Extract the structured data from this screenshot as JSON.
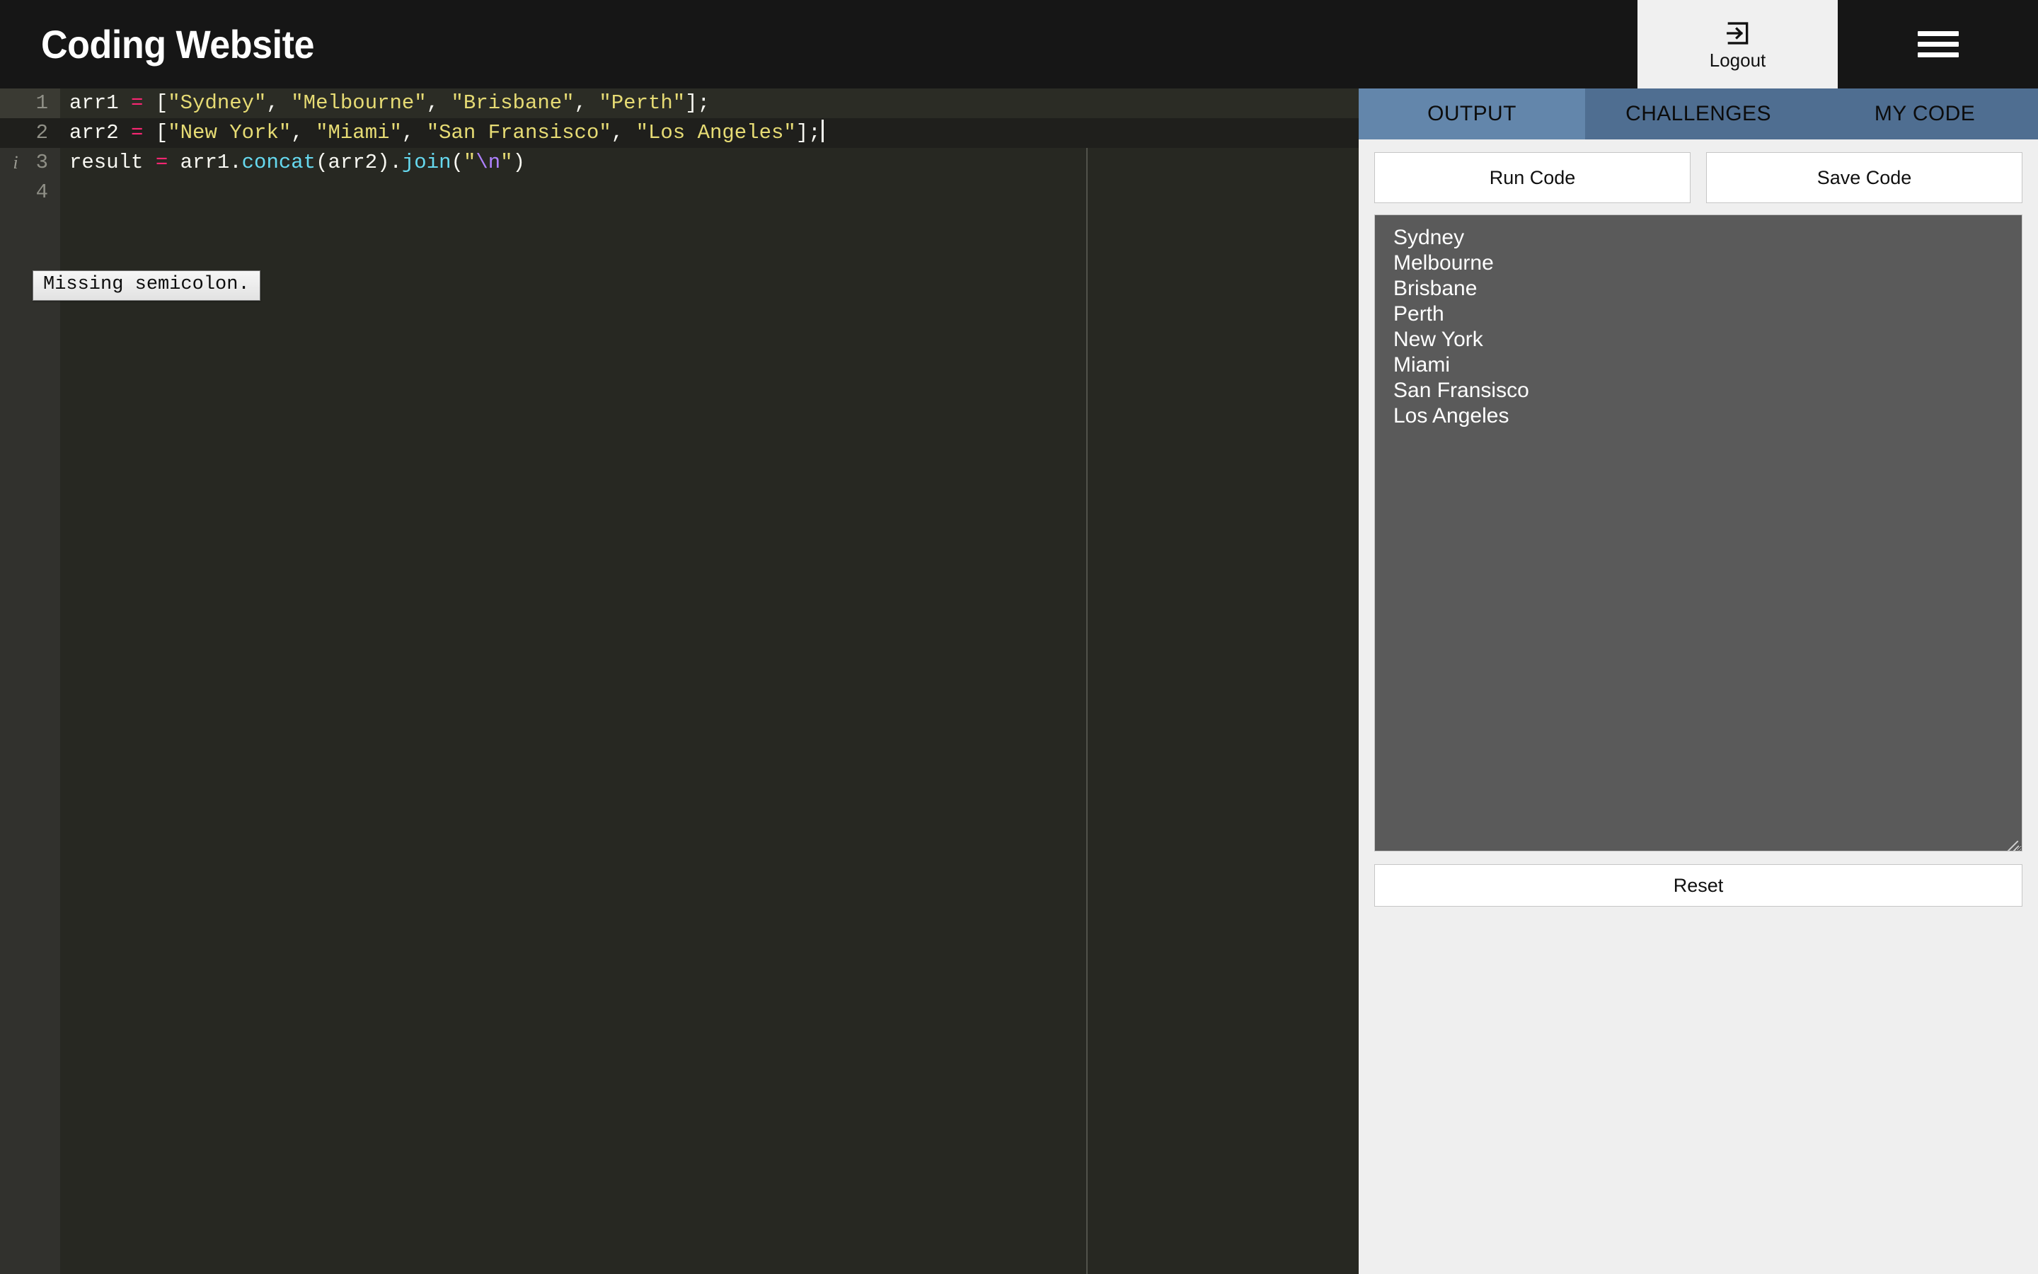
{
  "header": {
    "brand": "Coding Website",
    "logout_label": "Logout",
    "logout_icon": "logout-arrow-icon",
    "menu_icon": "hamburger-menu-icon"
  },
  "editor": {
    "language": "javascript",
    "active_line": 2,
    "cursor_line": 2,
    "theme_background": "#272822",
    "gutter_background": "#31312d",
    "lines": [
      {
        "number": "1",
        "marker": "",
        "tokens": [
          {
            "text": "arr1 ",
            "type": "plain"
          },
          {
            "text": "=",
            "type": "op"
          },
          {
            "text": " [",
            "type": "plain"
          },
          {
            "text": "\"Sydney\"",
            "type": "str"
          },
          {
            "text": ", ",
            "type": "plain"
          },
          {
            "text": "\"Melbourne\"",
            "type": "str"
          },
          {
            "text": ", ",
            "type": "plain"
          },
          {
            "text": "\"Brisbane\"",
            "type": "str"
          },
          {
            "text": ", ",
            "type": "plain"
          },
          {
            "text": "\"Perth\"",
            "type": "str"
          },
          {
            "text": "];",
            "type": "plain"
          }
        ]
      },
      {
        "number": "2",
        "marker": "",
        "tokens": [
          {
            "text": "arr2 ",
            "type": "plain"
          },
          {
            "text": "=",
            "type": "op"
          },
          {
            "text": " [",
            "type": "plain"
          },
          {
            "text": "\"New York\"",
            "type": "str"
          },
          {
            "text": ", ",
            "type": "plain"
          },
          {
            "text": "\"Miami\"",
            "type": "str"
          },
          {
            "text": ", ",
            "type": "plain"
          },
          {
            "text": "\"San Fransisco\"",
            "type": "str"
          },
          {
            "text": ", ",
            "type": "plain"
          },
          {
            "text": "\"Los Angeles\"",
            "type": "str"
          },
          {
            "text": "];",
            "type": "plain"
          }
        ]
      },
      {
        "number": "3",
        "marker": "i",
        "tokens": [
          {
            "text": "result ",
            "type": "plain"
          },
          {
            "text": "=",
            "type": "op"
          },
          {
            "text": " arr1.",
            "type": "plain"
          },
          {
            "text": "concat",
            "type": "fn"
          },
          {
            "text": "(arr2).",
            "type": "plain"
          },
          {
            "text": "join",
            "type": "fn"
          },
          {
            "text": "(",
            "type": "plain"
          },
          {
            "text": "\"",
            "type": "str"
          },
          {
            "text": "\\n",
            "type": "esc"
          },
          {
            "text": "\"",
            "type": "str"
          },
          {
            "text": ")",
            "type": "plain"
          }
        ]
      },
      {
        "number": "4",
        "marker": "",
        "tokens": []
      }
    ],
    "error_tooltip": "Missing semicolon."
  },
  "panel": {
    "tabs": [
      {
        "label": "OUTPUT",
        "active": true
      },
      {
        "label": "CHALLENGES",
        "active": false
      },
      {
        "label": "MY CODE",
        "active": false
      }
    ],
    "run_button": "Run Code",
    "save_button": "Save Code",
    "reset_button": "Reset",
    "output_text": "Sydney\nMelbourne\nBrisbane\nPerth\nNew York\nMiami\nSan Fransisco\nLos Angeles",
    "output_lines": [
      "Sydney",
      "Melbourne",
      "Brisbane",
      "Perth",
      "New York",
      "Miami",
      "San Fransisco",
      "Los Angeles"
    ]
  },
  "colors": {
    "header_bg": "#161616",
    "panel_bg": "#efefef",
    "tab_active": "#6386ab",
    "tab_inactive": "#4f6e91",
    "output_bg": "#5a5a5a",
    "editor_bg": "#272822",
    "string_token": "#e6db74",
    "operator_token": "#f92672",
    "function_token": "#66d9ef",
    "escape_token": "#ae81ff"
  }
}
